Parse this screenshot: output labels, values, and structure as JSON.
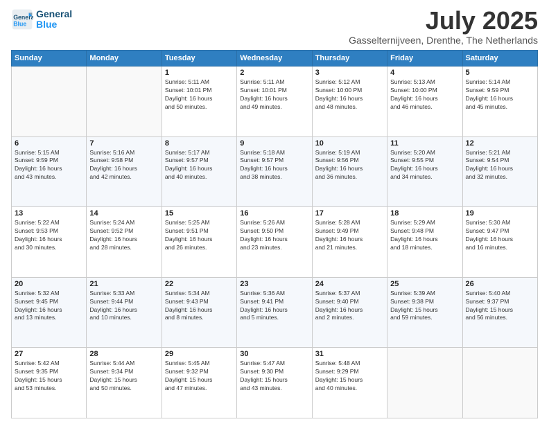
{
  "logo": {
    "line1": "General",
    "line2": "Blue"
  },
  "title": "July 2025",
  "subtitle": "Gasselternijveen, Drenthe, The Netherlands",
  "weekdays": [
    "Sunday",
    "Monday",
    "Tuesday",
    "Wednesday",
    "Thursday",
    "Friday",
    "Saturday"
  ],
  "weeks": [
    [
      {
        "day": "",
        "content": ""
      },
      {
        "day": "",
        "content": ""
      },
      {
        "day": "1",
        "content": "Sunrise: 5:11 AM\nSunset: 10:01 PM\nDaylight: 16 hours\nand 50 minutes."
      },
      {
        "day": "2",
        "content": "Sunrise: 5:11 AM\nSunset: 10:01 PM\nDaylight: 16 hours\nand 49 minutes."
      },
      {
        "day": "3",
        "content": "Sunrise: 5:12 AM\nSunset: 10:00 PM\nDaylight: 16 hours\nand 48 minutes."
      },
      {
        "day": "4",
        "content": "Sunrise: 5:13 AM\nSunset: 10:00 PM\nDaylight: 16 hours\nand 46 minutes."
      },
      {
        "day": "5",
        "content": "Sunrise: 5:14 AM\nSunset: 9:59 PM\nDaylight: 16 hours\nand 45 minutes."
      }
    ],
    [
      {
        "day": "6",
        "content": "Sunrise: 5:15 AM\nSunset: 9:59 PM\nDaylight: 16 hours\nand 43 minutes."
      },
      {
        "day": "7",
        "content": "Sunrise: 5:16 AM\nSunset: 9:58 PM\nDaylight: 16 hours\nand 42 minutes."
      },
      {
        "day": "8",
        "content": "Sunrise: 5:17 AM\nSunset: 9:57 PM\nDaylight: 16 hours\nand 40 minutes."
      },
      {
        "day": "9",
        "content": "Sunrise: 5:18 AM\nSunset: 9:57 PM\nDaylight: 16 hours\nand 38 minutes."
      },
      {
        "day": "10",
        "content": "Sunrise: 5:19 AM\nSunset: 9:56 PM\nDaylight: 16 hours\nand 36 minutes."
      },
      {
        "day": "11",
        "content": "Sunrise: 5:20 AM\nSunset: 9:55 PM\nDaylight: 16 hours\nand 34 minutes."
      },
      {
        "day": "12",
        "content": "Sunrise: 5:21 AM\nSunset: 9:54 PM\nDaylight: 16 hours\nand 32 minutes."
      }
    ],
    [
      {
        "day": "13",
        "content": "Sunrise: 5:22 AM\nSunset: 9:53 PM\nDaylight: 16 hours\nand 30 minutes."
      },
      {
        "day": "14",
        "content": "Sunrise: 5:24 AM\nSunset: 9:52 PM\nDaylight: 16 hours\nand 28 minutes."
      },
      {
        "day": "15",
        "content": "Sunrise: 5:25 AM\nSunset: 9:51 PM\nDaylight: 16 hours\nand 26 minutes."
      },
      {
        "day": "16",
        "content": "Sunrise: 5:26 AM\nSunset: 9:50 PM\nDaylight: 16 hours\nand 23 minutes."
      },
      {
        "day": "17",
        "content": "Sunrise: 5:28 AM\nSunset: 9:49 PM\nDaylight: 16 hours\nand 21 minutes."
      },
      {
        "day": "18",
        "content": "Sunrise: 5:29 AM\nSunset: 9:48 PM\nDaylight: 16 hours\nand 18 minutes."
      },
      {
        "day": "19",
        "content": "Sunrise: 5:30 AM\nSunset: 9:47 PM\nDaylight: 16 hours\nand 16 minutes."
      }
    ],
    [
      {
        "day": "20",
        "content": "Sunrise: 5:32 AM\nSunset: 9:45 PM\nDaylight: 16 hours\nand 13 minutes."
      },
      {
        "day": "21",
        "content": "Sunrise: 5:33 AM\nSunset: 9:44 PM\nDaylight: 16 hours\nand 10 minutes."
      },
      {
        "day": "22",
        "content": "Sunrise: 5:34 AM\nSunset: 9:43 PM\nDaylight: 16 hours\nand 8 minutes."
      },
      {
        "day": "23",
        "content": "Sunrise: 5:36 AM\nSunset: 9:41 PM\nDaylight: 16 hours\nand 5 minutes."
      },
      {
        "day": "24",
        "content": "Sunrise: 5:37 AM\nSunset: 9:40 PM\nDaylight: 16 hours\nand 2 minutes."
      },
      {
        "day": "25",
        "content": "Sunrise: 5:39 AM\nSunset: 9:38 PM\nDaylight: 15 hours\nand 59 minutes."
      },
      {
        "day": "26",
        "content": "Sunrise: 5:40 AM\nSunset: 9:37 PM\nDaylight: 15 hours\nand 56 minutes."
      }
    ],
    [
      {
        "day": "27",
        "content": "Sunrise: 5:42 AM\nSunset: 9:35 PM\nDaylight: 15 hours\nand 53 minutes."
      },
      {
        "day": "28",
        "content": "Sunrise: 5:44 AM\nSunset: 9:34 PM\nDaylight: 15 hours\nand 50 minutes."
      },
      {
        "day": "29",
        "content": "Sunrise: 5:45 AM\nSunset: 9:32 PM\nDaylight: 15 hours\nand 47 minutes."
      },
      {
        "day": "30",
        "content": "Sunrise: 5:47 AM\nSunset: 9:30 PM\nDaylight: 15 hours\nand 43 minutes."
      },
      {
        "day": "31",
        "content": "Sunrise: 5:48 AM\nSunset: 9:29 PM\nDaylight: 15 hours\nand 40 minutes."
      },
      {
        "day": "",
        "content": ""
      },
      {
        "day": "",
        "content": ""
      }
    ]
  ]
}
